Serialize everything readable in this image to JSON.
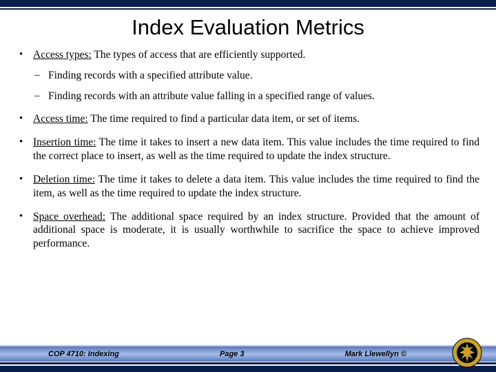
{
  "title": "Index Evaluation Metrics",
  "bullets": [
    {
      "label": "Access types:",
      "text": "  The types of access that are efficiently supported.",
      "sub": [
        "Finding records with a specified attribute value.",
        "Finding records with an attribute value falling in a specified range of values."
      ]
    },
    {
      "label": "Access time:",
      "text": "  The time required to find a particular data item, or set of items."
    },
    {
      "label": "Insertion time:",
      "text": "  The time it takes to insert a new data item.  This value includes the time required to find the correct place to insert, as well as the time required to update the index structure."
    },
    {
      "label": "Deletion time:",
      "text": "  The time it takes to delete a data item.  This value includes the time required to find the item, as well as the time required to update the index structure."
    },
    {
      "label": "Space overhead:",
      "text": " The additional space required by an index structure.  Provided that the amount of additional space is moderate, it is usually worthwhile to sacrifice the space to achieve improved performance."
    }
  ],
  "footer": {
    "course": "COP 4710: Indexing",
    "page": "Page 3",
    "author": "Mark Llewellyn ©"
  }
}
